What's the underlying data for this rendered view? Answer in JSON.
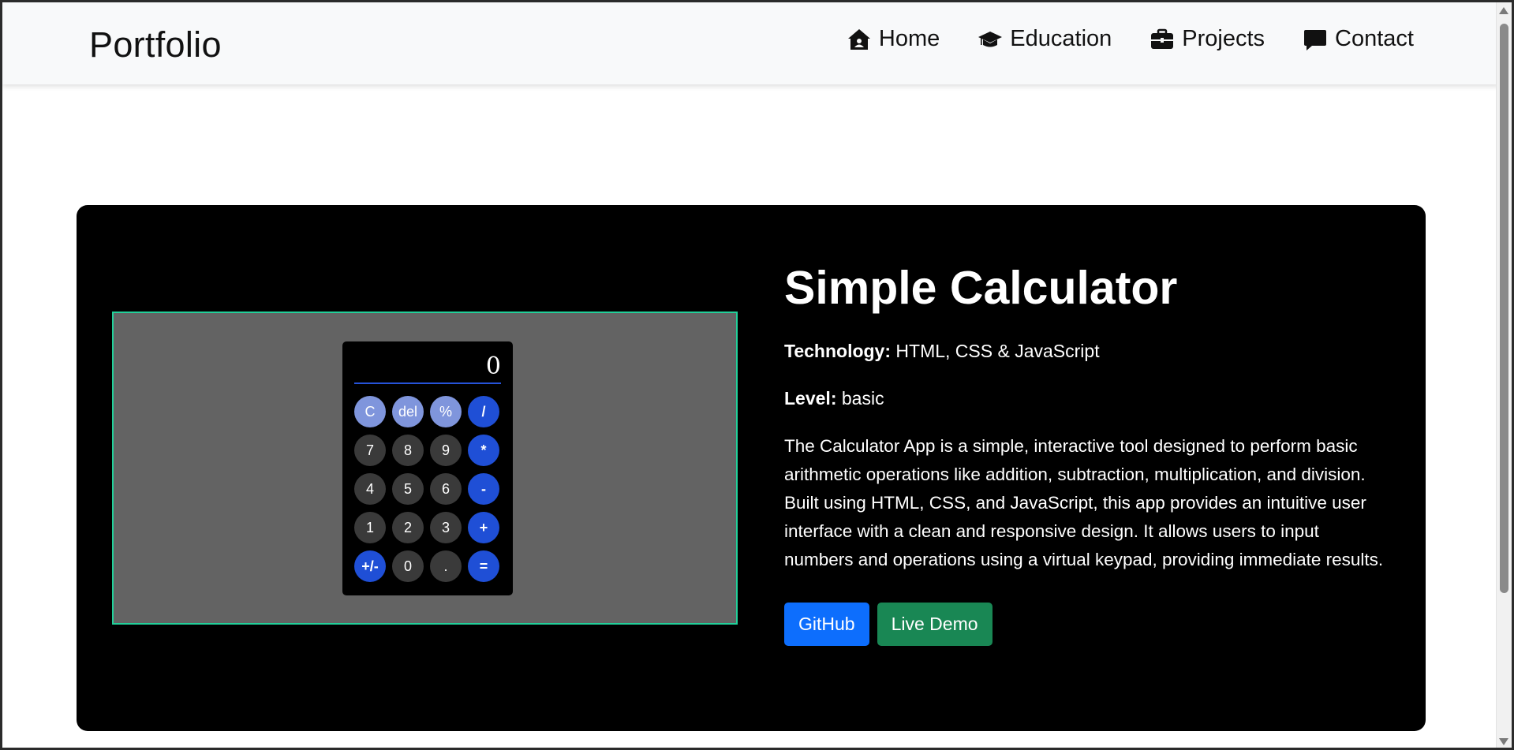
{
  "navbar": {
    "brand": "Portfolio",
    "items": [
      {
        "label": "Home",
        "icon": "house-icon"
      },
      {
        "label": "Education",
        "icon": "graduation-cap-icon"
      },
      {
        "label": "Projects",
        "icon": "briefcase-icon"
      },
      {
        "label": "Contact",
        "icon": "message-icon"
      }
    ]
  },
  "project": {
    "title": "Simple Calculator",
    "technology_label": "Technology:",
    "technology": "HTML, CSS & JavaScript",
    "level_label": "Level:",
    "level": "basic",
    "description": "The Calculator App is a simple, interactive tool designed to perform basic arithmetic operations like addition, subtraction, multiplication, and division. Built using HTML, CSS, and JavaScript, this app provides an intuitive user interface with a clean and responsive design. It allows users to input numbers and operations using a virtual keypad, providing immediate results.",
    "buttons": {
      "github": "GitHub",
      "demo": "Live Demo"
    }
  },
  "calculator": {
    "display": "0",
    "keys": [
      "C",
      "del",
      "%",
      "/",
      "7",
      "8",
      "9",
      "*",
      "4",
      "5",
      "6",
      "-",
      "1",
      "2",
      "3",
      "+",
      "+/-",
      "0",
      ".",
      "="
    ]
  },
  "colors": {
    "navbar_bg": "#f8f9fa",
    "card_bg": "#000000",
    "github_button": "#0d6efd",
    "demo_button": "#198754",
    "preview_border": "#22d09a"
  }
}
